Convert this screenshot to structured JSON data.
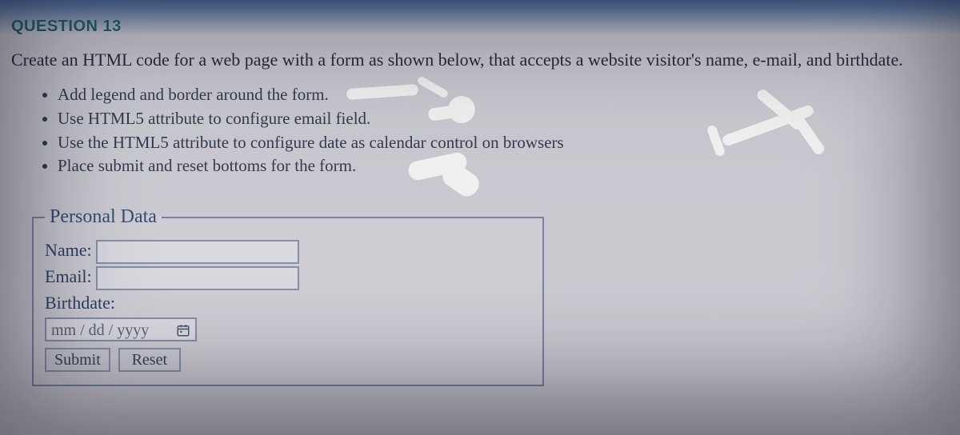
{
  "question_header": "QUESTION 13",
  "prompt": "Create an HTML code for a web page with a form as shown below, that accepts a website visitor's name, e-mail, and birthdate.",
  "bullets": [
    "Add legend and border around the form.",
    "Use HTML5 attribute to configure email field.",
    "Use the HTML5 attribute to configure date as calendar control on browsers",
    "Place submit and reset bottoms for the form."
  ],
  "calendar_word": "calendar",
  "form": {
    "legend": "Personal Data",
    "name_label": "Name:",
    "email_label": "Email:",
    "birthdate_label": "Birthdate:",
    "date_placeholder": "mm / dd / yyyy",
    "submit_label": "Submit",
    "reset_label": "Reset"
  }
}
